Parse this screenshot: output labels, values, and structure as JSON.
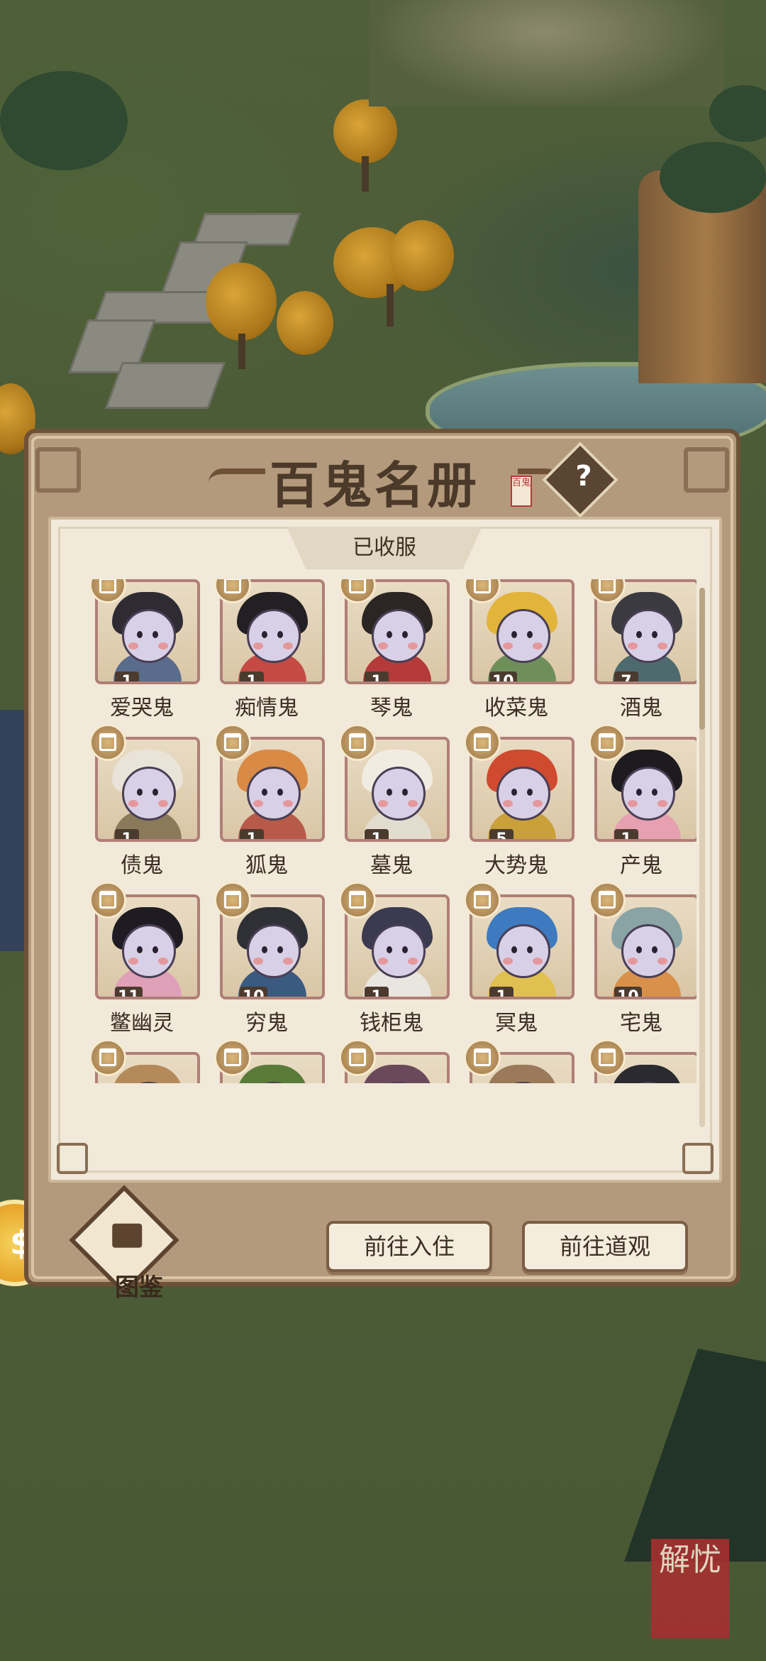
{
  "dialog": {
    "title": "百鬼名册",
    "seal_text": "百鬼",
    "help_label": "?",
    "tab_label": "已收服",
    "footer": {
      "codex_label": "图鉴",
      "goto_residence": "前往入住",
      "goto_temple": "前往道观"
    }
  },
  "ghosts": [
    {
      "name": "爱哭鬼",
      "level": "1",
      "hair": "#2f2b33",
      "robe": "#5a6c8c"
    },
    {
      "name": "痴情鬼",
      "level": "1",
      "hair": "#222022",
      "robe": "#c54a44"
    },
    {
      "name": "琴鬼",
      "level": "1",
      "hair": "#2b2624",
      "robe": "#b53a3a"
    },
    {
      "name": "收菜鬼",
      "level": "10",
      "hair": "#e2b43a",
      "robe": "#6f8f5a"
    },
    {
      "name": "酒鬼",
      "level": "7",
      "hair": "#3a3a40",
      "robe": "#4d6a6e"
    },
    {
      "name": "债鬼",
      "level": "1",
      "hair": "#e9e3d8",
      "robe": "#8a7a5a"
    },
    {
      "name": "狐鬼",
      "level": "1",
      "hair": "#d98a45",
      "robe": "#b85a4a"
    },
    {
      "name": "墓鬼",
      "level": "1",
      "hair": "#f1ece2",
      "robe": "#e3ddd0"
    },
    {
      "name": "大势鬼",
      "level": "5",
      "hair": "#d04a30",
      "robe": "#c9a03a"
    },
    {
      "name": "产鬼",
      "level": "1",
      "hair": "#1d1b1f",
      "robe": "#e6a0b0"
    },
    {
      "name": "鳖幽灵",
      "level": "11",
      "hair": "#1e1c22",
      "robe": "#e0a0b8"
    },
    {
      "name": "穷鬼",
      "level": "10",
      "hair": "#2e3036",
      "robe": "#3a5a80"
    },
    {
      "name": "钱柜鬼",
      "level": "1",
      "hair": "#3a3a50",
      "robe": "#e9e6e0"
    },
    {
      "name": "冥鬼",
      "level": "1",
      "hair": "#3d7ac0",
      "robe": "#e0c050"
    },
    {
      "name": "宅鬼",
      "level": "10",
      "hair": "#8aa3a5",
      "robe": "#d9904a"
    },
    {
      "name": "",
      "level": "",
      "hair": "#b58a5a",
      "robe": "#e6a6c0"
    },
    {
      "name": "",
      "level": "",
      "hair": "#5a7a3a",
      "robe": "#4a3a2a"
    },
    {
      "name": "",
      "level": "",
      "hair": "#6a4a5a",
      "robe": "#e8d8e0"
    },
    {
      "name": "",
      "level": "",
      "hair": "#9a7a5a",
      "robe": "#d8c8b0"
    },
    {
      "name": "",
      "level": "",
      "hair": "#2a2a30",
      "robe": "#80b0d0"
    }
  ],
  "scene": {
    "stamp_text": "解忧"
  }
}
